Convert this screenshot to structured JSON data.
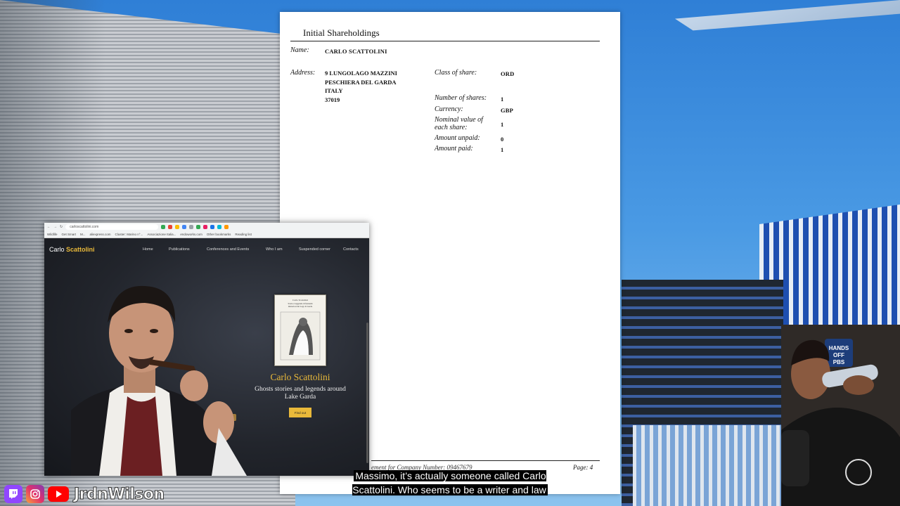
{
  "document": {
    "title": "Initial Shareholdings",
    "name_label": "Name:",
    "name_value": "CARLO SCATTOLINI",
    "address_label": "Address:",
    "address_lines": [
      "9 LUNGOLAGO MAZZINI",
      "PESCHIERA DEL GARDA",
      "ITALY",
      "37019"
    ],
    "fields": [
      {
        "label": "Class of share:",
        "value": "ORD"
      },
      {
        "label": "Number of shares:",
        "value": "1"
      },
      {
        "label": "Currency:",
        "value": "GBP"
      },
      {
        "label": "Nominal value of each share:",
        "value": "1"
      },
      {
        "label": "Amount unpaid:",
        "value": "0"
      },
      {
        "label": "Amount paid:",
        "value": "1"
      }
    ],
    "footer": "ement for Company Number: 09467679",
    "page_label": "Page: 4"
  },
  "browser": {
    "url": "carloscattolini.com",
    "bookmarks": [
      "Wildlife",
      "Get Smart",
      "M...",
      "aliexpress.com",
      "Cluster: Marino n°...",
      "Associazione Italia...",
      "endoworks.com",
      "Other bookmarks",
      "Reading list"
    ],
    "site": {
      "logo_first": "Carlo",
      "logo_second": "Scattolini",
      "nav": [
        "Home",
        "Publications",
        "Conferences and Events",
        "Who I am",
        "Suspended corner",
        "Contacts"
      ],
      "hero_name": "Carlo Scattolini",
      "hero_subtitle": "Ghosts stories and legends around Lake Garda",
      "hero_button": "Find out",
      "book_author": "Carlo Scattolini",
      "book_title": "Storie e leggende di fantasmi misteriosi del Lago di Garda"
    }
  },
  "overlay": {
    "caption": "Massimo, it’s actually someone called Carlo Scattolini. Who seems to be a writer and law",
    "handle": "JrdnWilson",
    "cam_sign": "HANDS OFF PBS"
  },
  "colors": {
    "accent_gold": "#e9b93a",
    "twitch": "#9146ff",
    "youtube": "#ff0000"
  }
}
